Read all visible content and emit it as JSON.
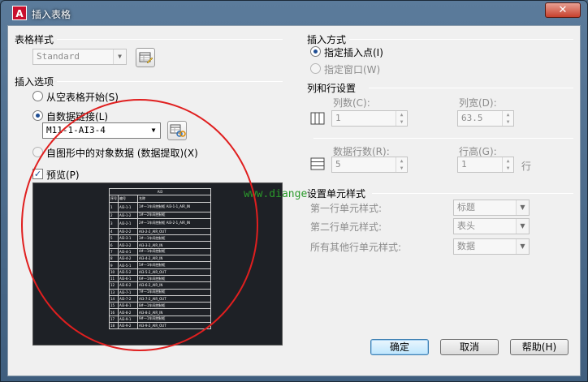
{
  "window": {
    "title": "插入表格",
    "app_icon": "A",
    "close_glyph": "✕"
  },
  "table_style": {
    "section_label": "表格样式",
    "dropdown_value": "Standard",
    "edit_icon": "table-style-edit-icon"
  },
  "insert_options": {
    "section_label": "插入选项",
    "from_empty": "从空表格开始(S)",
    "from_data_link": "自数据链接(L)",
    "data_link_value": "M11-1-AI3-4",
    "link_icon": "data-link-manager-icon",
    "from_object_data": "自图形中的对象数据 (数据提取)(X)",
    "selected": "from_data_link"
  },
  "preview": {
    "checkbox_label": "预览(P)",
    "checked": true,
    "table_title": "AI3",
    "table_headers": [
      "序号",
      "编号",
      "名称"
    ],
    "rows": [
      [
        "1",
        "AI3-1-1",
        "1#—1车间控制柜\nAI3-1-1_AIR_IN"
      ],
      [
        "2",
        "AI3-1-2",
        "1#—2车间控制柜"
      ],
      [
        "3",
        "AI3-2-1",
        "2#—1车间控制柜\nAI3-2-1_AIR_IN"
      ],
      [
        "4",
        "AI3-2-2",
        "AI3-2-2_AIR_OUT"
      ],
      [
        "5",
        "AI3-3-1",
        "3#—1车间控制柜"
      ],
      [
        "6",
        "AI3-3-2",
        "AI3-3-2_AIR_IN"
      ],
      [
        "7",
        "AI3-4-1",
        "4#—1车间控制柜"
      ],
      [
        "8",
        "AI3-4-2",
        "AI3-4-2_AIR_IN"
      ],
      [
        "9",
        "AI3-5-1",
        "5#—1车间控制柜"
      ],
      [
        "10",
        "AI3-5-2",
        "AI3-5-2_AIR_OUT"
      ],
      [
        "11",
        "AI3-6-1",
        "6#—1车间控制柜"
      ],
      [
        "12",
        "AI3-6-2",
        "AI3-6-2_AIR_IN"
      ],
      [
        "13",
        "AI3-7-1",
        "7#—1车间控制柜"
      ],
      [
        "14",
        "AI3-7-2",
        "AI3-7-2_AIR_OUT"
      ],
      [
        "15",
        "AI3-8-1",
        "8#—1车间控制柜"
      ],
      [
        "16",
        "AI3-8-2",
        "AI3-8-2_AIR_IN"
      ],
      [
        "17",
        "AI3-9-1",
        "9#—1车间控制柜"
      ],
      [
        "18",
        "AI3-9-2",
        "AI3-9-2_AIR_OUT"
      ]
    ]
  },
  "insert_method": {
    "section_label": "插入方式",
    "insertion_point": "指定插入点(I)",
    "window": "指定窗口(W)",
    "selected": "insertion_point"
  },
  "rows_columns": {
    "section_label": "列和行设置",
    "columns_label": "列数(C):",
    "columns_value": "1",
    "column_width_label": "列宽(D):",
    "column_width_value": "63.5",
    "data_rows_label": "数据行数(R):",
    "data_rows_value": "5",
    "row_height_label": "行高(G):",
    "row_height_value": "1",
    "row_unit": "行",
    "columns_icon": "columns-icon",
    "rows_icon": "rows-icon"
  },
  "cell_styles": {
    "section_label": "设置单元样式",
    "first_row_label": "第一行单元样式:",
    "first_row_value": "标题",
    "second_row_label": "第二行单元样式:",
    "second_row_value": "表头",
    "other_rows_label": "所有其他行单元样式:",
    "other_rows_value": "数据"
  },
  "buttons": {
    "ok": "确定",
    "cancel": "取消",
    "help": "帮助(H)"
  },
  "overlay": {
    "watermark_text": "www.diange",
    "circle_color": "#e01f1f"
  }
}
